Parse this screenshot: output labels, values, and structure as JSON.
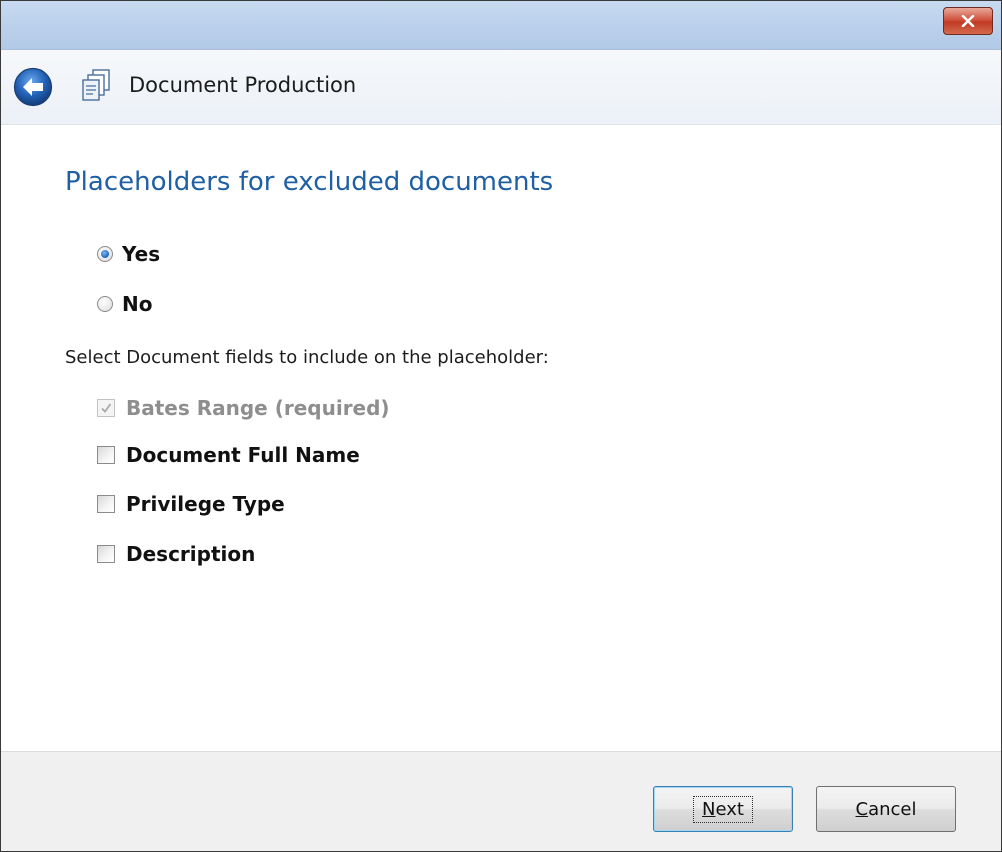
{
  "window": {
    "nav_title": "Document Production"
  },
  "heading": "Placeholders for excluded documents",
  "options": {
    "yes_label": "Yes",
    "no_label": "No",
    "selected": "Yes"
  },
  "instruction": "Select Document fields to include on the placeholder:",
  "fields": [
    {
      "label": "Bates Range (required)",
      "checked": true,
      "disabled": true
    },
    {
      "label": "Document Full Name",
      "checked": false,
      "disabled": false
    },
    {
      "label": "Privilege Type",
      "checked": false,
      "disabled": false
    },
    {
      "label": "Description",
      "checked": false,
      "disabled": false
    }
  ],
  "buttons": {
    "next_mnemonic": "N",
    "next_rest": "ext",
    "cancel_mnemonic": "C",
    "cancel_rest": "ancel"
  },
  "icons": {
    "close": "close-icon",
    "back": "back-arrow-icon",
    "app": "document-production-icon"
  },
  "colors": {
    "heading": "#1f5fa3",
    "close_button": "#c03a25"
  }
}
